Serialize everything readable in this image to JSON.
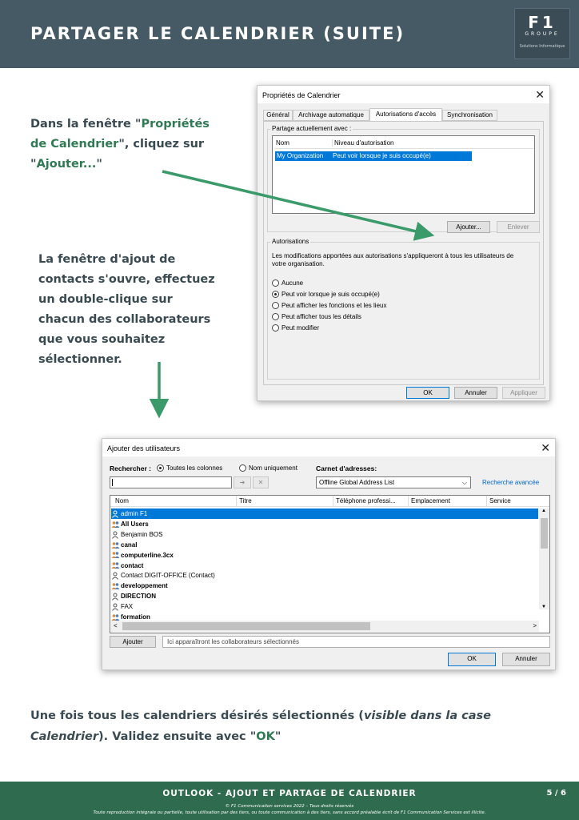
{
  "header": {
    "title": "PARTAGER LE CALENDRIER (SUITE)",
    "logo_line1": "F1",
    "logo_line2": "GROUPE",
    "logo_line3": "Solutions Informatique"
  },
  "step1": {
    "t1": "Dans la fenêtre \"",
    "t2": "Propriétés",
    "t3": "de Calendrier",
    "t4": "\", cliquez sur",
    "t5": "\"",
    "t6": "Ajouter...",
    "t7": "\""
  },
  "step2": {
    "lines": [
      "La fenêtre d'ajout de",
      "contacts s'ouvre, effectuez",
      "un double-clique sur",
      "chacun des collaborateurs",
      "que vous souhaitez",
      "sélectionner."
    ]
  },
  "step3": {
    "t1": "Une fois tous les calendriers désirés sélectionnés (",
    "t2": "visible dans la case",
    "t3": "Calendrier",
    "t4": "). Validez ensuite avec \"",
    "t5": "OK",
    "t6": "\""
  },
  "props_dialog": {
    "title": "Propriétés de Calendrier",
    "close": "✕",
    "tabs": [
      "Général",
      "Archivage automatique",
      "Autorisations d'accès",
      "Synchronisation"
    ],
    "share_group": "Partage actuellement avec :",
    "col_name": "Nom",
    "col_level": "Niveau d'autorisation",
    "row_name": "My Organization",
    "row_level": "Peut voir lorsque je suis occupé(e)",
    "add_btn": "Ajouter...",
    "remove_btn": "Enlever",
    "perm_group": "Autorisations",
    "perm_text1": "Les modifications apportées aux autorisations s'appliqueront à tous les utilisateurs de",
    "perm_text2": "votre organisation.",
    "options": [
      "Aucune",
      "Peut voir lorsque je suis occupé(e)",
      "Peut afficher les fonctions et les lieux",
      "Peut afficher tous les détails",
      "Peut modifier"
    ],
    "selected_option": 1,
    "ok": "OK",
    "cancel": "Annuler",
    "apply": "Appliquer"
  },
  "add_dialog": {
    "title": "Ajouter des utilisateurs",
    "close": "✕",
    "search_label": "Rechercher :",
    "opt_all": "Toutes les colonnes",
    "opt_name": "Nom uniquement",
    "addr_label": "Carnet d'adresses:",
    "addr_value": "Offline Global Address List",
    "advanced": "Recherche avancée",
    "go_icon": "➔",
    "clear_icon": "✕",
    "columns": [
      "Nom",
      "Titre",
      "Téléphone professi...",
      "Emplacement",
      "Service"
    ],
    "rows": [
      {
        "name": "admin F1",
        "icon": "user-icon",
        "bold": false,
        "selected": true
      },
      {
        "name": "All Users",
        "icon": "group-icon",
        "bold": true,
        "selected": false
      },
      {
        "name": "Benjamin BOS",
        "icon": "user-icon",
        "bold": false,
        "selected": false
      },
      {
        "name": "canal",
        "icon": "group-icon",
        "bold": true,
        "selected": false
      },
      {
        "name": "computerline.3cx",
        "icon": "group-icon",
        "bold": true,
        "selected": false
      },
      {
        "name": "contact",
        "icon": "group-icon",
        "bold": true,
        "selected": false
      },
      {
        "name": "Contact DIGIT-OFFICE (Contact)",
        "icon": "user-icon",
        "bold": false,
        "selected": false
      },
      {
        "name": "developpement",
        "icon": "group-icon",
        "bold": true,
        "selected": false
      },
      {
        "name": "DIRECTION",
        "icon": "user-icon",
        "bold": true,
        "selected": false
      },
      {
        "name": "FAX",
        "icon": "user-icon",
        "bold": false,
        "selected": false
      },
      {
        "name": "formation",
        "icon": "group-icon",
        "bold": true,
        "selected": false
      }
    ],
    "add_btn": "Ajouter",
    "selected_placeholder": "Ici apparaîtront les collaborateurs sélectionnés",
    "ok": "OK",
    "cancel": "Annuler"
  },
  "footer": {
    "title": "OUTLOOK - AJOUT ET PARTAGE DE CALENDRIER",
    "page": "5 / 6",
    "copyright1": "© F1 Communication services 2022 – Tous droits réservés",
    "copyright2": "Toute reproduction intégrale ou partielle, toute utilisation par des tiers, ou toute communication à des tiers, sans accord préalable écrit de F1 Communication Services est illicite."
  },
  "colors": {
    "header_bg": "#465a66",
    "footer_bg": "#2f6b4e",
    "accent_green": "#2f7a52",
    "arrow_green": "#3a9a6a",
    "selection_blue": "#0078d7"
  }
}
